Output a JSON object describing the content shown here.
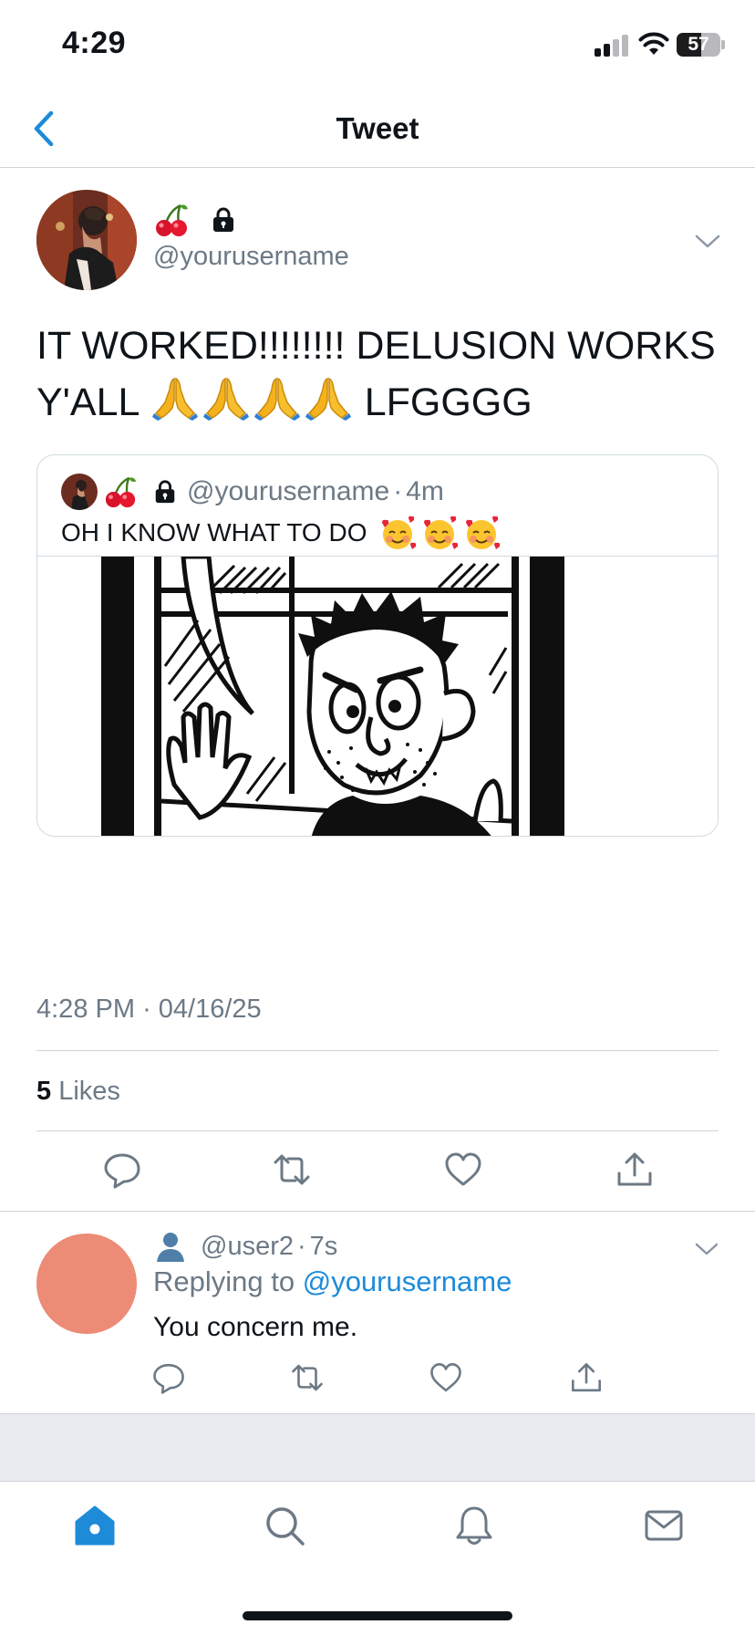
{
  "status_bar": {
    "time": "4:29",
    "battery_level": "57",
    "battery_fraction": 0.57
  },
  "header": {
    "title": "Tweet",
    "back_icon": "chevron-left-icon"
  },
  "tweet": {
    "handle": "@yourusername",
    "name_emoji": "cherry",
    "lock_icon": "lock-icon",
    "text_part1": "IT WORKED!!!!!!!! DELUSION WORKS Y'ALL",
    "text_part2": "LFGGGG",
    "pray_emoji_count": 4,
    "quote": {
      "handle": "@yourusername",
      "separator": "·",
      "time": "4m",
      "text": "OH I KNOW WHAT TO DO",
      "blush_emoji_count": 3,
      "image": "comic-man-at-window"
    },
    "meta": {
      "time": "4:28 PM",
      "separator": "·",
      "date": "04/16/25"
    },
    "likes": {
      "count": "5",
      "label": "Likes"
    },
    "actions": [
      "reply-icon",
      "retweet-icon",
      "heart-icon",
      "share-icon"
    ]
  },
  "reply": {
    "handle": "@user2",
    "separator": "·",
    "time": "7s",
    "replying_prefix": "Replying to",
    "replying_handle": "@yourusername",
    "text": "You concern me.",
    "avatar_color": "#ec8b76"
  },
  "tab_bar": {
    "tabs": [
      "home-icon",
      "search-icon",
      "bell-icon",
      "mail-icon"
    ],
    "active": "home-icon"
  },
  "colors": {
    "accent": "#1d8bd8",
    "muted_text": "#6c7985",
    "divider": "#cfd4d9"
  }
}
